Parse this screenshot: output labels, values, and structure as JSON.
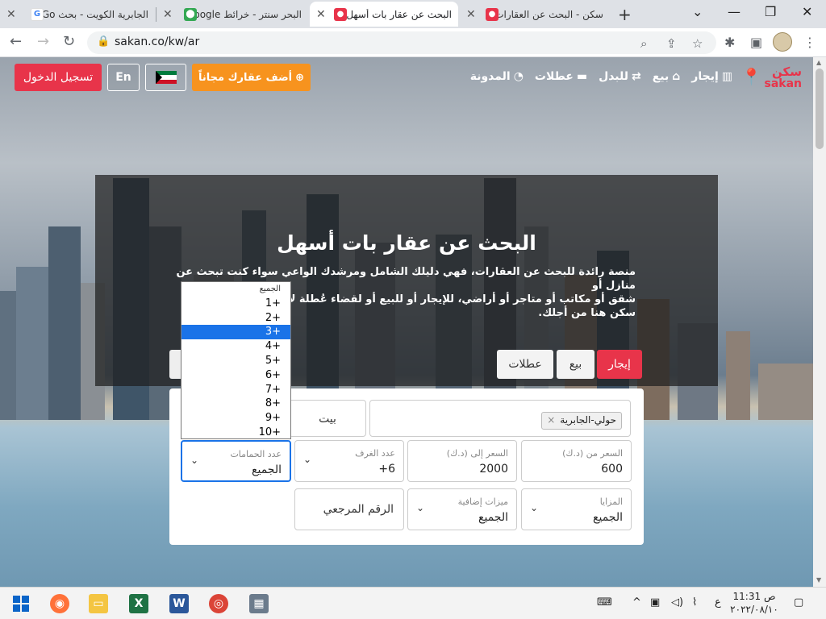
{
  "browser": {
    "tabs": [
      {
        "title": "الجابرية الكويت - بحث Go",
        "favicon": "G",
        "active": false
      },
      {
        "title": "البحر سنتر - خرائط Google",
        "favicon": "maps",
        "active": false
      },
      {
        "title": "البحث عن عقار بات أسهل",
        "favicon": "pin",
        "active": true
      },
      {
        "title": "سكن - البحث عن العقارات",
        "favicon": "pin",
        "active": false
      }
    ],
    "new_tab": "+",
    "url": "sakan.co/kw/ar"
  },
  "site": {
    "logo_ar": "سكن",
    "logo_en": "sakan",
    "nav": [
      {
        "label": "إيجار",
        "icon": "building-icon"
      },
      {
        "label": "بيع",
        "icon": "home-icon"
      },
      {
        "label": "للبدل",
        "icon": "swap-icon"
      },
      {
        "label": "عطلات",
        "icon": "bed-icon"
      },
      {
        "label": "المدونة",
        "icon": "blog-icon"
      }
    ],
    "add_property": "أضف عقارك مجاناً",
    "lang": "En",
    "login": "تسجيل الدخول",
    "accent": "#e8344a",
    "orange": "#f7931e"
  },
  "hero": {
    "title": "البحث عن عقار بات أسهل",
    "line1": "منصة رائدة للبحث عن العقارات، فهي دليلك الشامل ومرشدك الواعي سواء كنت تبحث عن منازل أو",
    "line2": "شقق أو مكاتب أو متاجر أو أراضي، للإيجار أو للبيع أو لقضاء عُطلة لا تنسى،",
    "line3": "سكن هنا من أجلك."
  },
  "search": {
    "tabs": {
      "rent": "إيجار",
      "sale": "بيع",
      "holidays": "عطلات"
    },
    "location_chip": "حولي-الجابرية",
    "chip_remove": "×",
    "property_type": "بيت",
    "price_from_label": "السعر من (د.ك)",
    "price_from": "600",
    "price_to_label": "السعر إلى (د.ك)",
    "price_to": "2000",
    "rooms_label": "عدد الغرف",
    "rooms": "6+",
    "baths_label": "عدد الحمامات",
    "baths": "الجميع",
    "features_label": "المزايا",
    "features": "الجميع",
    "extras_label": "ميزات إضافية",
    "extras": "الجميع",
    "ref_placeholder": "الرقم المرجعي"
  },
  "dropdown": {
    "options": [
      "الجميع",
      "1+",
      "2+",
      "3+",
      "4+",
      "5+",
      "6+",
      "7+",
      "8+",
      "9+",
      "10+"
    ],
    "selected": "3+"
  },
  "taskbar": {
    "time": "11:31 ص",
    "date": "٢٠٢٢/٠٨/١٠",
    "lang": "ع"
  }
}
